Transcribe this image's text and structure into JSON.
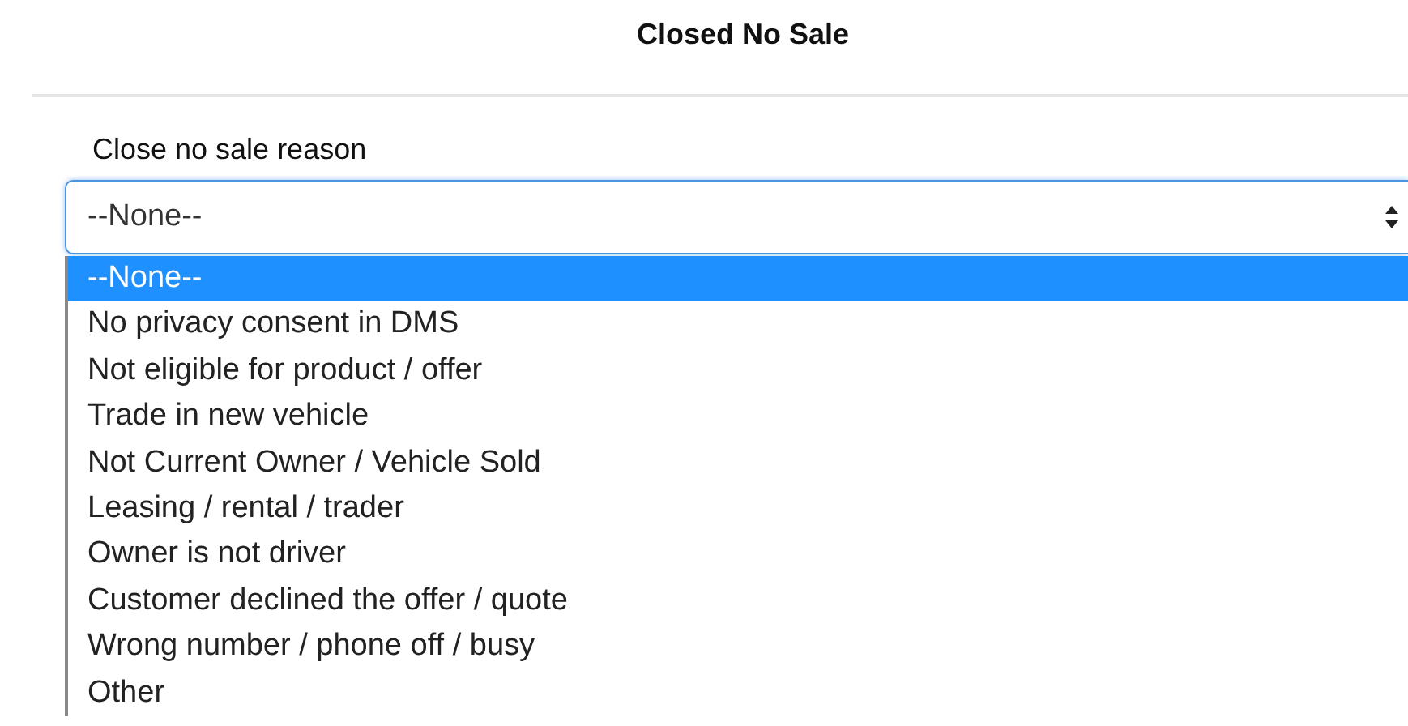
{
  "dialog": {
    "title": "Closed No Sale"
  },
  "field": {
    "label": "Close no sale reason",
    "value": "--None--",
    "expanded": true
  },
  "options": [
    {
      "label": "--None--",
      "selected": true
    },
    {
      "label": "No privacy consent in DMS",
      "selected": false
    },
    {
      "label": "Not eligible for product / offer",
      "selected": false
    },
    {
      "label": "Trade in new vehicle",
      "selected": false
    },
    {
      "label": "Not Current Owner / Vehicle Sold",
      "selected": false
    },
    {
      "label": "Leasing / rental / trader",
      "selected": false
    },
    {
      "label": "Owner is not driver",
      "selected": false
    },
    {
      "label": "Customer declined the offer / quote",
      "selected": false
    },
    {
      "label": "Wrong number / phone off / busy",
      "selected": false
    },
    {
      "label": "Other",
      "selected": false
    }
  ]
}
